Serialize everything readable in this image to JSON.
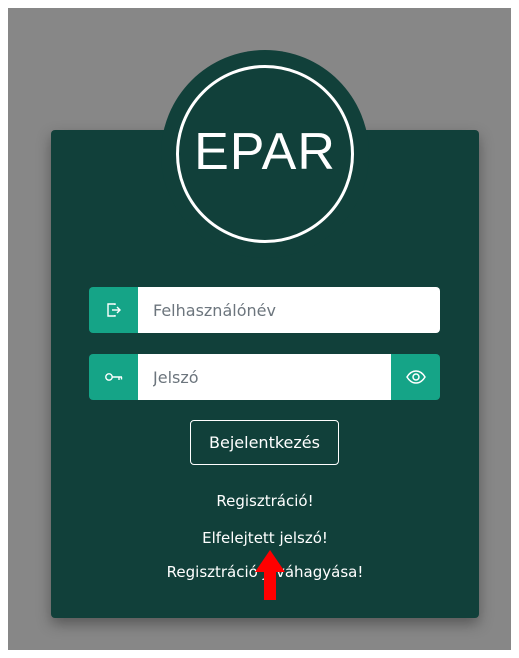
{
  "logo": {
    "text": "EPAR"
  },
  "login_form": {
    "username_placeholder": "Felhasználónév",
    "password_placeholder": "Jelszó",
    "username_icon": "sign-in-icon",
    "password_icon": "key-icon",
    "toggle_password_icon": "eye-icon",
    "submit_label": "Bejelentkezés"
  },
  "links": {
    "register": "Regisztráció!",
    "forgot_password": "Elfelejtett jelszó!",
    "confirm_registration": "Regisztráció jóváhagyása!"
  },
  "colors": {
    "card_background": "#11403a",
    "accent": "#15a487",
    "page_background": "#878787",
    "annotation_arrow": "#ff0000"
  }
}
